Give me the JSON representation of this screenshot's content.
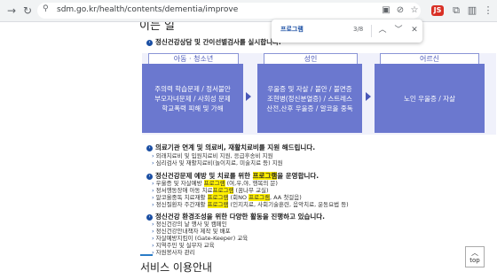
{
  "browser": {
    "url": "sdm.go.kr/health/contents/dementia/improve",
    "back_icon": "→",
    "reload_icon": "↻",
    "ext_badge": "JS"
  },
  "find_bar": {
    "query": "프로그램",
    "count": "3/8",
    "prev": "︿",
    "next": "﹀",
    "close": "✕"
  },
  "page": {
    "partial_heading": "이는 일",
    "intro": "정신건강상담 및 간이선별검사를 실시합니다.",
    "columns": [
      {
        "label": "아동 · 청소년",
        "text": [
          "주의력 학습문제 / 정서불안",
          "부모자녀문제 / 사회성 문제",
          "학교폭력 피해 및 가해"
        ]
      },
      {
        "label": "성인",
        "text": [
          "우울증 및 자살 / 불안 / 불면증",
          "조현병(정신분열증) / 스트레스",
          "산전,산후 우울증 / 알코올 중독"
        ]
      },
      {
        "label": "어르신",
        "text": [
          "노인 우울증 / 자살"
        ]
      }
    ],
    "section2_title": "의료기관 연계 및 의료비, 재활치료비를 지원 해드립니다.",
    "section2_items": [
      "외래치료비 및 입원치료비 지원, 응급후송비 지원",
      "심리검사 및 재활치료비(놀이치료, 미술치료 등) 지원"
    ],
    "section3_title_a": "정신건강문제 예방 및 치료를 위한 ",
    "section3_title_hl": "프로그램",
    "section3_title_b": "을 운영합니다.",
    "section3_items": [
      {
        "a": "우울증 및 자살예방 ",
        "hl": "프로그램",
        "b": " (여,우,야, 행복의 문)"
      },
      {
        "a": "정서행동장애 아동 치료",
        "hl": "프로그램",
        "b": " (꿈나무 교실)"
      },
      {
        "a": "알코올중독 치료재활 ",
        "hl": "프로그램",
        "b": " (회NO ",
        "hl2": "프로그램",
        "c": ", AA 첫걸음)"
      },
      {
        "a": "정신질환자 주간재활 ",
        "hl": "프로그램",
        "b": " (인지치료, 사회기술훈련, 음악치료, 운동요법 등)"
      }
    ],
    "section4_title": "정신건강 환경조성을 위한 다양한 활동을 진행하고 있습니다.",
    "section4_items": [
      "정신건강의 날 행사 및 캠페인",
      "정신건강안내책자 제작 및 배포",
      "자살예방지킴이 (Gate-Keeper) 교육",
      "지역주민 및 실무자 교육",
      "자원봉사자 관리"
    ],
    "next_heading": "서비스 이용안내",
    "top_label": "top"
  }
}
